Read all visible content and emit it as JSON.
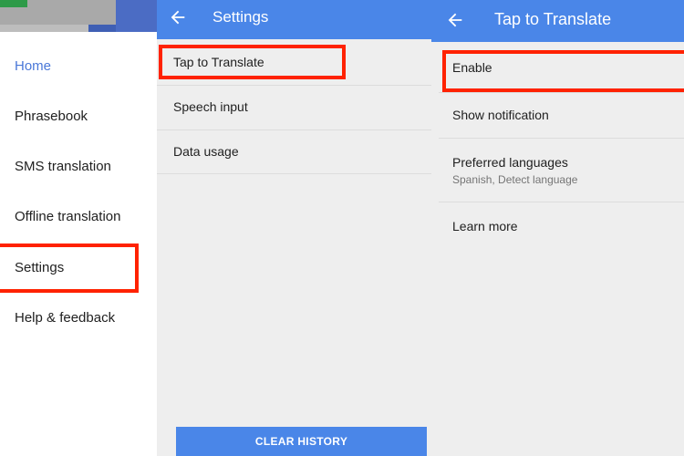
{
  "drawer": {
    "items": [
      {
        "label": "Home",
        "active": true
      },
      {
        "label": "Phrasebook"
      },
      {
        "label": "SMS translation"
      },
      {
        "label": "Offline translation"
      },
      {
        "label": "Settings",
        "highlighted": true
      },
      {
        "label": "Help & feedback"
      }
    ]
  },
  "settings": {
    "title": "Settings",
    "back_icon": "arrow-left-icon",
    "items": [
      {
        "label": "Tap to Translate",
        "highlighted": true
      },
      {
        "label": "Speech input"
      },
      {
        "label": "Data usage"
      }
    ],
    "clear_history_label": "CLEAR HISTORY"
  },
  "tap_to_translate": {
    "title": "Tap to Translate",
    "back_icon": "arrow-left-icon",
    "enable_label": "Enable",
    "show_notification_label": "Show notification",
    "preferred_languages_label": "Preferred languages",
    "preferred_languages_value": "Spanish, Detect language",
    "learn_more_label": "Learn more"
  },
  "colors": {
    "app_bar": "#4a86e8",
    "active_nav": "#4a78d8",
    "highlight": "#ff2200",
    "panel_bg": "#eeeeee"
  }
}
